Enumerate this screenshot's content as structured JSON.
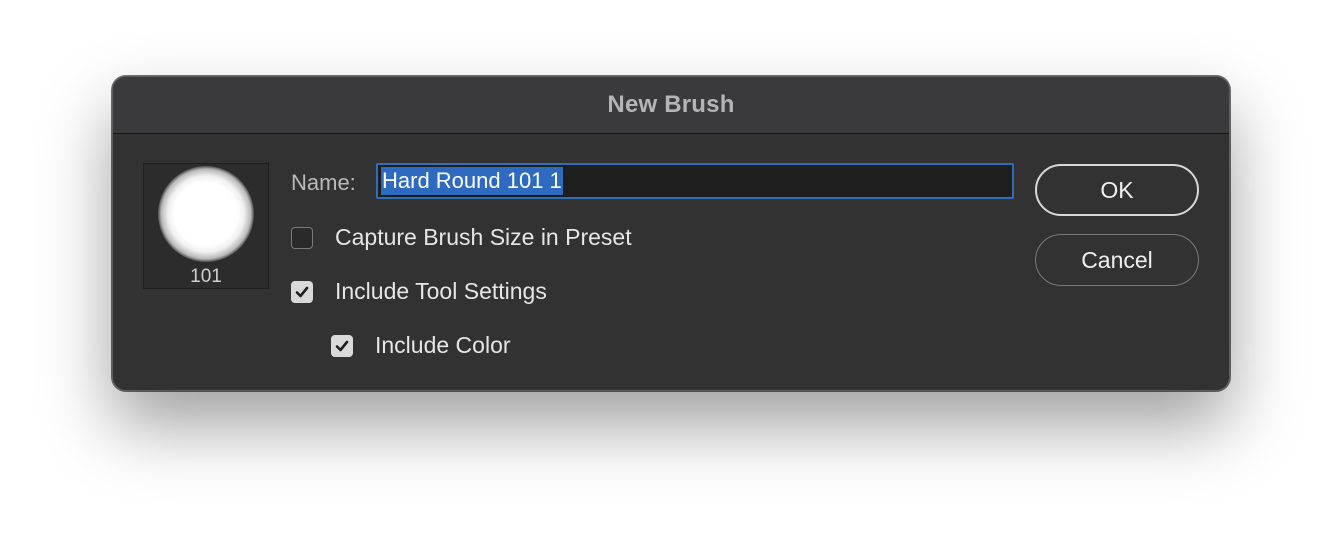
{
  "dialog": {
    "title": "New Brush",
    "preview": {
      "brush_icon": "soft-round-brush-tip",
      "size": "101"
    },
    "name": {
      "label": "Name:",
      "value": "Hard Round 101 1",
      "selected": true
    },
    "options": [
      {
        "label": "Capture Brush Size in Preset",
        "checked": false
      },
      {
        "label": "Include Tool Settings",
        "checked": true
      },
      {
        "label": "Include Color",
        "checked": true
      }
    ],
    "buttons": {
      "ok": "OK",
      "cancel": "Cancel"
    },
    "colors": {
      "background": "#323232",
      "selection": "#2e6bc0",
      "focus_ring": "#2f6fb9"
    }
  }
}
